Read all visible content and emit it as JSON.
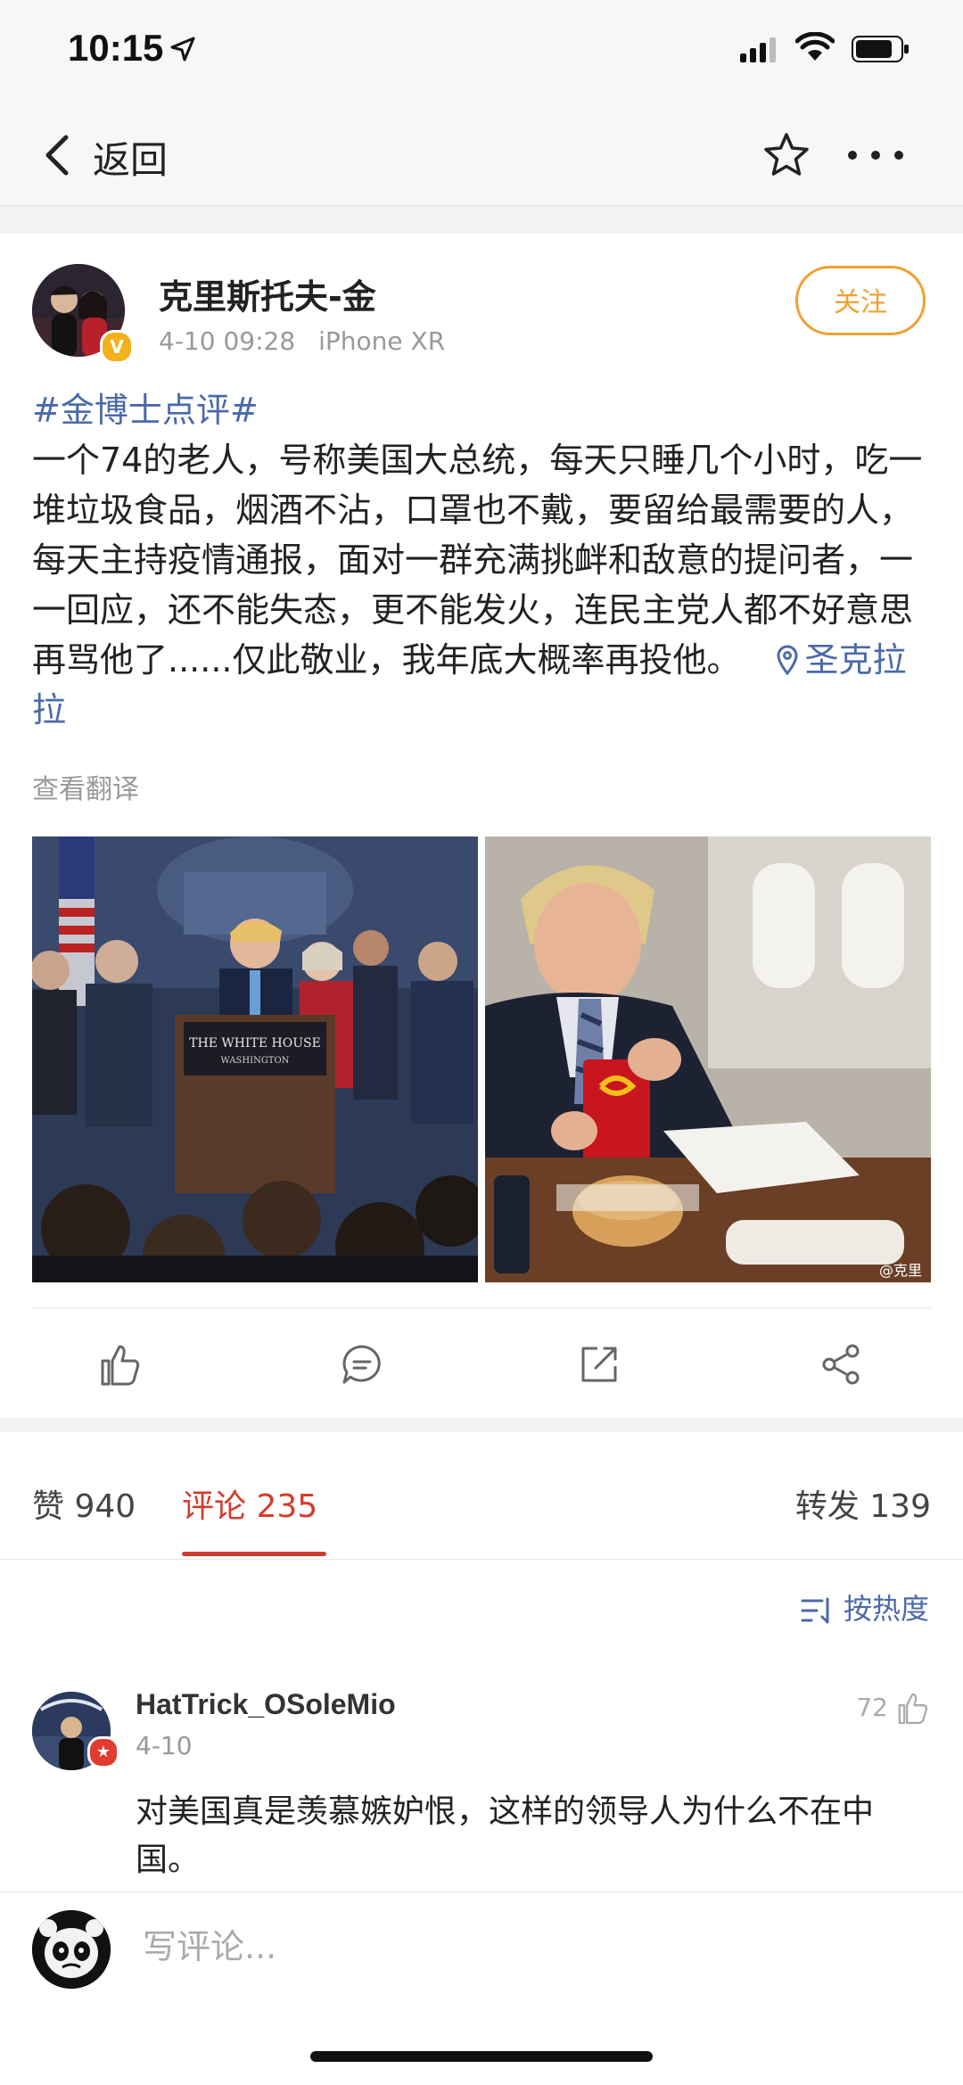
{
  "status": {
    "time": "10:15"
  },
  "nav": {
    "back_label": "返回"
  },
  "post": {
    "author": "克里斯托夫-金",
    "date": "4-10 09:28",
    "device": "iPhone XR",
    "follow_label": "关注",
    "hashtag": "#金博士点评#",
    "body": "一个74的老人，号称美国大总统，每天只睡几个小时，吃一堆垃圾食品，烟酒不沾，口罩也不戴，要留给最需要的人，每天主持疫情通报，面对一群充满挑衅和敌意的提问者，一一回应，还不能失态，更不能发火，连民主党人都不好意思再骂他了......仅此敬业，我年底大概率再投他。",
    "location": "圣克拉拉",
    "translate_label": "查看翻译",
    "photo1": {
      "podium_text": "THE WHITE HOUSE",
      "podium_sub": "WASHINGTON"
    },
    "photo2": {
      "watermark": "@克里"
    }
  },
  "tabs": {
    "likes": "赞 940",
    "comments": "评论 235",
    "reposts": "转发 139"
  },
  "comments": {
    "sort_label": "按热度",
    "items": [
      {
        "name": "HatTrick_OSoleMio",
        "date": "4-10",
        "likes": "72",
        "text": "对美国真是羡慕嫉妒恨，这样的领导人为什么不在中国。"
      }
    ]
  },
  "input": {
    "placeholder": "写评论..."
  },
  "colors": {
    "accent_blue": "#4b6aa8",
    "tab_red": "#d23c2f",
    "follow_orange": "#f0a030"
  }
}
